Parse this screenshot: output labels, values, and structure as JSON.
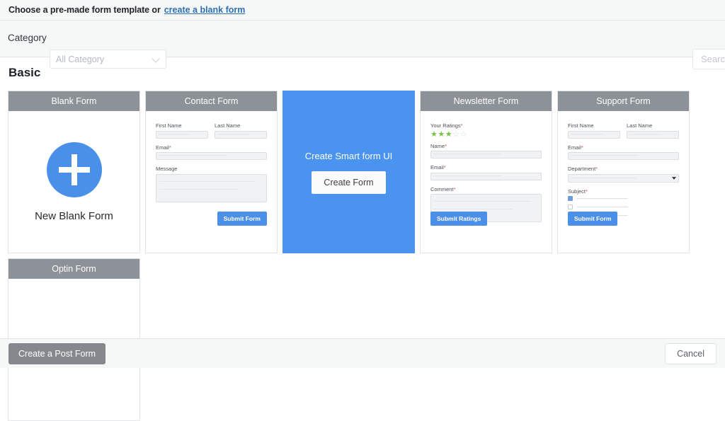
{
  "header": {
    "prompt": "Choose a pre-made form template or",
    "link": "create a blank form"
  },
  "filter": {
    "category_label": "Category",
    "category_value": "All Category",
    "search_placeholder": "Search"
  },
  "section": {
    "title": "Basic"
  },
  "cards": {
    "blank": {
      "title": "Blank Form",
      "label": "New Blank Form"
    },
    "contact": {
      "title": "Contact Form",
      "first_name": "First Name",
      "last_name": "Last Name",
      "email": "Email",
      "required_mark": "*",
      "message": "Message",
      "submit": "Submit Form"
    },
    "hover": {
      "title": "Create Smart form UI",
      "button": "Create Form"
    },
    "newsletter": {
      "title": "Newsletter Form",
      "ratings_label": "Your Ratings",
      "stars_filled": 3,
      "stars_total": 5,
      "name": "Name",
      "email": "Email",
      "comment": "Comment",
      "submit": "Submit Ratings"
    },
    "support": {
      "title": "Support Form",
      "first_name": "First Name",
      "last_name": "Last Name",
      "email": "Email",
      "department": "Department",
      "subject": "Subject",
      "submit": "Submit Form"
    },
    "optin": {
      "title": "Optin Form"
    }
  },
  "footer": {
    "create_post": "Create a Post Form",
    "cancel": "Cancel"
  },
  "colors": {
    "accent_blue": "#4a90e8",
    "hover_blue": "#4a94ef",
    "header_gray": "#8d9198",
    "star_green": "#7ac043",
    "required_red": "#e04a3f",
    "link_blue": "#2f6fb0"
  }
}
